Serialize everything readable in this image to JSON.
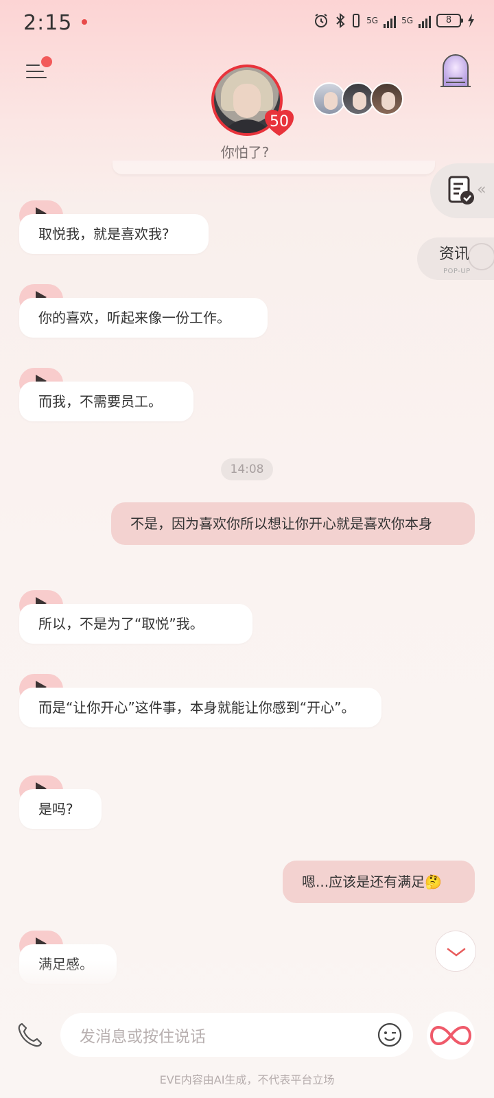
{
  "status_bar": {
    "time": "2:15",
    "network_a": "5G",
    "network_b": "5G",
    "battery": "8"
  },
  "header": {
    "affection_level": "50",
    "subtitle": "你怕了?",
    "icons": {
      "menu": "menu-icon",
      "door": "door-icon",
      "doc": "document-check-icon",
      "heart": "heart-icon"
    }
  },
  "side_panel": {
    "news_label": "资讯",
    "news_sub": "POP-UP",
    "collapse_arrows": "‹‹"
  },
  "messages": [
    {
      "from": "bot",
      "text": "取悦我，就是喜欢我?"
    },
    {
      "from": "bot",
      "text": "你的喜欢，听起来像一份工作。"
    },
    {
      "from": "bot",
      "text": "而我，不需要员工。"
    },
    {
      "from": "time",
      "text": "14:08"
    },
    {
      "from": "user",
      "text": "不是，因为喜欢你所以想让你开心就是喜欢你本身"
    },
    {
      "from": "bot",
      "text": "所以，不是为了“取悦”我。"
    },
    {
      "from": "bot",
      "text": "而是“让你开心”这件事，本身就能让你感到“开心”。"
    },
    {
      "from": "bot",
      "text": "是吗?"
    },
    {
      "from": "user",
      "text": "嗯...应该是还有满足🤔"
    },
    {
      "from": "bot",
      "text": "满足感。"
    }
  ],
  "input": {
    "placeholder": "发消息或按住说话"
  },
  "footer": {
    "disclaimer": "EVE内容由AI生成，不代表平台立场"
  },
  "colors": {
    "accent": "#e8333b",
    "user_bubble": "#f3d2d0",
    "play_badge": "#f8cccc"
  }
}
